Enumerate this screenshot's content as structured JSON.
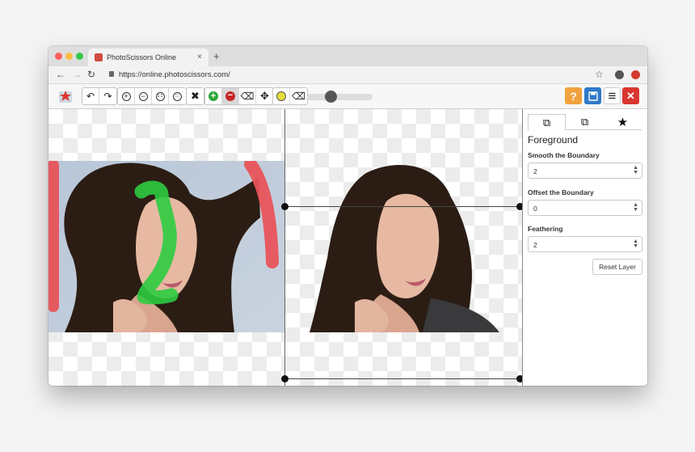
{
  "browser": {
    "tab_title": "PhotoScissors Online",
    "tab_close": "×",
    "new_tab": "+",
    "back": "←",
    "forward": "→",
    "reload": "↻",
    "url": "https://online.photoscissors.com/",
    "bookmark": "☆"
  },
  "toolbar": {
    "undo": "↶",
    "redo": "↷",
    "zoom_in": "+",
    "zoom_out": "−",
    "zoom_actual": "1:1",
    "zoom_fit": "□",
    "clear": "✖",
    "add_foreground": "+",
    "remove_background": "−",
    "eraser": "⌫",
    "move": "✥",
    "hair_marker": "●",
    "hair_eraser": "⌫",
    "help": "?",
    "save": "💾",
    "menu": "≡",
    "close": "✕",
    "brush_size_fraction": 0.33
  },
  "panel": {
    "tabs": [
      "⧉",
      "⧉",
      "★"
    ],
    "title": "Foreground",
    "smooth_label": "Smooth the Boundary",
    "smooth_value": "2",
    "offset_label": "Offset the Boundary",
    "offset_value": "0",
    "feathering_label": "Feathering",
    "feathering_value": "2",
    "reset_label": "Reset Layer"
  },
  "colors": {
    "foreground_marker": "#2ecc40",
    "background_marker": "#e8545a",
    "help_button": "#f0a23c",
    "save_button": "#2f79c9",
    "close_button": "#d9362f"
  }
}
